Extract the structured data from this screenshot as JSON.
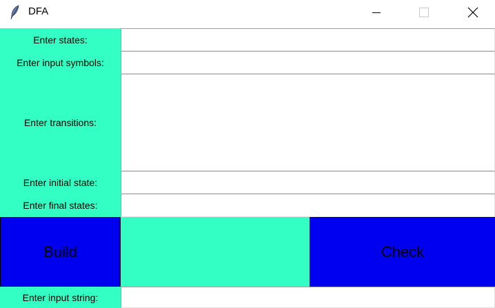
{
  "window": {
    "title": "DFA",
    "icon": "feather-icon",
    "controls": [
      "minimize-icon",
      "maximize-icon",
      "close-icon"
    ]
  },
  "colors": {
    "label_background": "#33ffc4",
    "button_background": "#0000f0",
    "entry_background": "#ffffff"
  },
  "form": {
    "states_label": "Enter states:",
    "states_value": "",
    "input_symbols_label": "Enter input symbols:",
    "input_symbols_value": "",
    "transitions_label": "Enter transitions:",
    "transitions_value": "",
    "initial_state_label": "Enter initial state:",
    "initial_state_value": "",
    "final_states_label": "Enter final states:",
    "final_states_value": "",
    "input_string_label": "Enter input string:",
    "input_string_value": ""
  },
  "buttons": {
    "build_label": "Build",
    "check_label": "Check"
  }
}
